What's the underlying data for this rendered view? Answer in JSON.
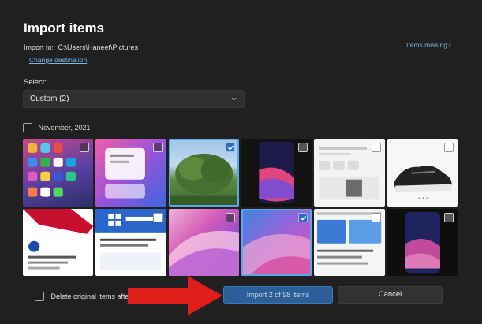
{
  "dialog": {
    "title": "Import items",
    "import_to_label": "Import to:",
    "import_to_path": "C:\\Users\\Haneet\\Pictures",
    "change_destination": "Change destination",
    "items_missing": "Items missing?",
    "select_label": "Select:",
    "select_value": "Custom (2)",
    "group_label": "November, 2021",
    "delete_label": "Delete original items after",
    "import_button": "Import 2 of 98 items",
    "cancel_button": "Cancel"
  },
  "thumbnails": [
    {
      "name": "thumb-iphone-homescreen",
      "selected": false
    },
    {
      "name": "thumb-purple-widget",
      "selected": false
    },
    {
      "name": "thumb-tree-photo",
      "selected": true
    },
    {
      "name": "thumb-dark-phone",
      "selected": false
    },
    {
      "name": "thumb-web-shop",
      "selected": false
    },
    {
      "name": "thumb-sneaker",
      "selected": false
    },
    {
      "name": "thumb-red-phone-tweet",
      "selected": false
    },
    {
      "name": "thumb-windows11-article",
      "selected": false
    },
    {
      "name": "thumb-pink-wallpaper",
      "selected": false
    },
    {
      "name": "thumb-blue-wallpaper",
      "selected": true
    },
    {
      "name": "thumb-web-article",
      "selected": false
    },
    {
      "name": "thumb-phone-lockscreen",
      "selected": false
    }
  ],
  "colors": {
    "background": "#202020",
    "accent": "#2c5e99",
    "link": "#7ab6e8",
    "annotation_arrow": "#e01c1c"
  }
}
